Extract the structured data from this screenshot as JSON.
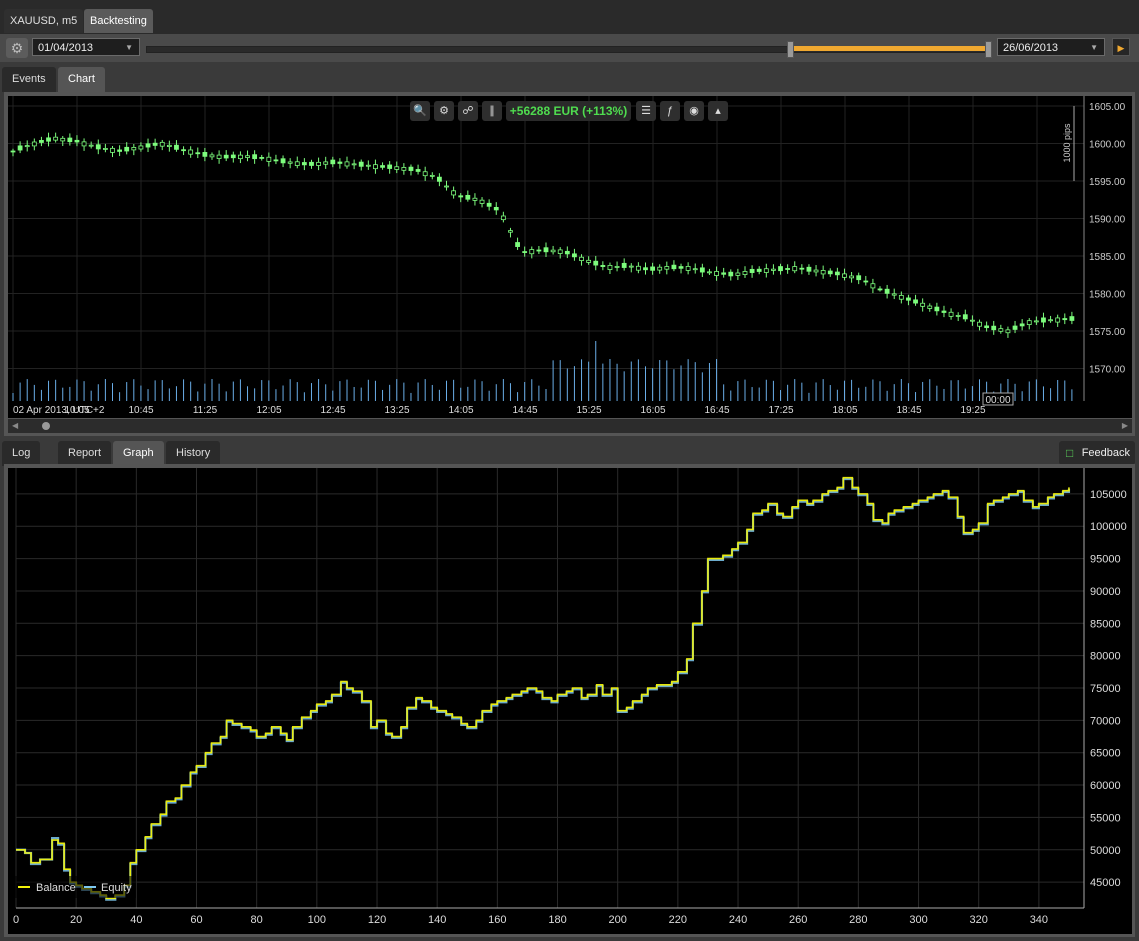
{
  "window": {
    "tabs": [
      {
        "label": "XAUUSD, m5",
        "active": false
      },
      {
        "label": "Backtesting",
        "active": true
      }
    ]
  },
  "controls": {
    "start_date": "01/04/2013",
    "end_date": "26/06/2013",
    "range_fraction": [
      0.768,
      1.0
    ]
  },
  "top_tabs": [
    {
      "label": "Events",
      "active": false
    },
    {
      "label": "Chart",
      "active": true
    }
  ],
  "price_chart": {
    "pnl_badge": "+56288 EUR (+113%)",
    "pips_label": "1000 pips",
    "price_ticks": [
      "1605.00",
      "1600.00",
      "1595.00",
      "1590.00",
      "1585.00",
      "1580.00",
      "1575.00",
      "1570.00"
    ],
    "time_labels": [
      "02 Apr 2013, UTC+2",
      "10:05",
      "10:45",
      "11:25",
      "12:05",
      "12:45",
      "13:25",
      "14:05",
      "14:45",
      "15:25",
      "16:05",
      "16:45",
      "17:25",
      "18:05",
      "18:45",
      "19:25"
    ],
    "crosshair_label": "00:00",
    "candle_color": "#7dfc7d",
    "volume_color": "#6aaee8"
  },
  "bottom_tabs": [
    {
      "label": "Log",
      "active": false
    },
    {
      "label": "Report",
      "active": false
    },
    {
      "label": "Graph",
      "active": true
    },
    {
      "label": "History",
      "active": false
    }
  ],
  "feedback_label": "Feedback",
  "chart_data": {
    "type": "line",
    "title": "",
    "xlabel": "",
    "ylabel": "",
    "xlim": [
      0,
      355
    ],
    "ylim": [
      41000,
      109000
    ],
    "x_ticks": [
      0,
      20,
      40,
      60,
      80,
      100,
      120,
      140,
      160,
      180,
      200,
      220,
      240,
      260,
      280,
      300,
      320,
      340
    ],
    "y_ticks": [
      45000,
      50000,
      55000,
      60000,
      65000,
      70000,
      75000,
      80000,
      85000,
      90000,
      95000,
      100000,
      105000
    ],
    "grid": true,
    "legend": "bottom-left",
    "series": [
      {
        "name": "Balance",
        "color": "#f2f20a",
        "x": [
          0,
          3,
          5,
          8,
          12,
          14,
          16,
          18,
          20,
          22,
          25,
          28,
          30,
          33,
          36,
          38,
          40,
          43,
          45,
          48,
          50,
          53,
          55,
          58,
          60,
          63,
          65,
          68,
          70,
          72,
          75,
          78,
          80,
          83,
          85,
          88,
          90,
          92,
          95,
          98,
          100,
          103,
          105,
          108,
          110,
          112,
          115,
          118,
          120,
          123,
          125,
          128,
          130,
          133,
          135,
          138,
          140,
          143,
          145,
          148,
          150,
          153,
          155,
          158,
          160,
          163,
          165,
          168,
          170,
          173,
          175,
          178,
          180,
          183,
          185,
          188,
          190,
          193,
          195,
          198,
          200,
          203,
          205,
          208,
          210,
          213,
          215,
          218,
          220,
          223,
          225,
          228,
          230,
          233,
          235,
          238,
          240,
          243,
          245,
          248,
          250,
          253,
          255,
          258,
          260,
          263,
          265,
          268,
          270,
          273,
          275,
          278,
          280,
          283,
          285,
          288,
          290,
          292,
          295,
          298,
          300,
          303,
          305,
          308,
          310,
          313,
          315,
          318,
          320,
          323,
          325,
          328,
          330,
          333,
          335,
          338,
          340,
          343,
          345,
          348,
          350
        ],
        "y": [
          50000,
          49500,
          48000,
          48500,
          51500,
          51000,
          47000,
          45000,
          44500,
          44000,
          43500,
          43000,
          42500,
          43000,
          44500,
          48000,
          50000,
          52000,
          54000,
          55500,
          57500,
          58000,
          60000,
          62000,
          63000,
          65000,
          66500,
          67500,
          70000,
          69500,
          69000,
          68500,
          67500,
          68000,
          69000,
          68000,
          67000,
          69000,
          70500,
          71500,
          72500,
          73000,
          74000,
          76000,
          75000,
          74500,
          73000,
          69000,
          70000,
          68000,
          67500,
          69000,
          72000,
          73500,
          73000,
          72000,
          71500,
          71000,
          70500,
          69500,
          69000,
          70000,
          71500,
          72500,
          73000,
          73500,
          74000,
          74500,
          75000,
          74500,
          73500,
          73000,
          74000,
          74500,
          75000,
          73500,
          74000,
          75500,
          74000,
          75000,
          71500,
          72000,
          73000,
          74000,
          75000,
          75500,
          75500,
          76000,
          77500,
          79500,
          85000,
          90000,
          95000,
          95000,
          95500,
          96500,
          97500,
          99500,
          102000,
          102500,
          103500,
          102000,
          101500,
          103000,
          104000,
          103500,
          104000,
          105000,
          105500,
          106000,
          107500,
          106000,
          105000,
          103500,
          101000,
          100500,
          102000,
          102500,
          103000,
          103500,
          104000,
          104500,
          105000,
          105500,
          104500,
          101500,
          99000,
          99500,
          100500,
          103500,
          104000,
          104500,
          105000,
          105500,
          104000,
          103000,
          103500,
          104500,
          105000,
          105500,
          106000
        ]
      },
      {
        "name": "Equity",
        "color": "#7ec8f0",
        "x": [
          0,
          3,
          5,
          8,
          12,
          14,
          16,
          18,
          20,
          22,
          25,
          28,
          30,
          33,
          36,
          38,
          40,
          43,
          45,
          48,
          50,
          53,
          55,
          58,
          60,
          63,
          65,
          68,
          70,
          72,
          75,
          78,
          80,
          83,
          85,
          88,
          90,
          92,
          95,
          98,
          100,
          103,
          105,
          108,
          110,
          112,
          115,
          118,
          120,
          123,
          125,
          128,
          130,
          133,
          135,
          138,
          140,
          143,
          145,
          148,
          150,
          153,
          155,
          158,
          160,
          163,
          165,
          168,
          170,
          173,
          175,
          178,
          180,
          183,
          185,
          188,
          190,
          193,
          195,
          198,
          200,
          203,
          205,
          208,
          210,
          213,
          215,
          218,
          220,
          223,
          225,
          228,
          230,
          233,
          235,
          238,
          240,
          243,
          245,
          248,
          250,
          253,
          255,
          258,
          260,
          263,
          265,
          268,
          270,
          273,
          275,
          278,
          280,
          283,
          285,
          288,
          290,
          292,
          295,
          298,
          300,
          303,
          305,
          308,
          310,
          313,
          315,
          318,
          320,
          323,
          325,
          328,
          330,
          333,
          335,
          338,
          340,
          343,
          345,
          348,
          350
        ],
        "y": [
          50000,
          49500,
          47800,
          48500,
          51800,
          50800,
          46800,
          44800,
          44300,
          43800,
          43300,
          42800,
          42300,
          42800,
          44300,
          47800,
          49800,
          51800,
          53800,
          55300,
          57300,
          57800,
          59800,
          61800,
          62800,
          64800,
          66300,
          67300,
          69800,
          69300,
          68800,
          68300,
          67300,
          67800,
          68800,
          67800,
          66800,
          68800,
          70300,
          71300,
          72300,
          72800,
          73800,
          75800,
          74800,
          74300,
          72800,
          68800,
          69800,
          67800,
          67300,
          68800,
          71800,
          73300,
          72800,
          71800,
          71300,
          70800,
          70300,
          69300,
          68800,
          69800,
          71300,
          72300,
          72800,
          73300,
          73800,
          74300,
          74800,
          74300,
          73300,
          72800,
          73800,
          74300,
          74800,
          73300,
          73800,
          75300,
          73800,
          74800,
          71300,
          71800,
          72800,
          73800,
          74800,
          75300,
          75300,
          75800,
          77300,
          79300,
          84800,
          89800,
          94800,
          94800,
          95300,
          96300,
          97300,
          99300,
          101800,
          102300,
          103300,
          101800,
          101300,
          102800,
          103800,
          103300,
          103800,
          104800,
          105300,
          105800,
          107300,
          105800,
          104800,
          103300,
          100800,
          100300,
          101800,
          102300,
          102800,
          103300,
          103800,
          104300,
          104800,
          105300,
          104300,
          101300,
          98800,
          99300,
          100300,
          103300,
          103800,
          104300,
          104800,
          105300,
          103800,
          102800,
          103300,
          104300,
          104800,
          105300,
          105800
        ]
      }
    ]
  }
}
